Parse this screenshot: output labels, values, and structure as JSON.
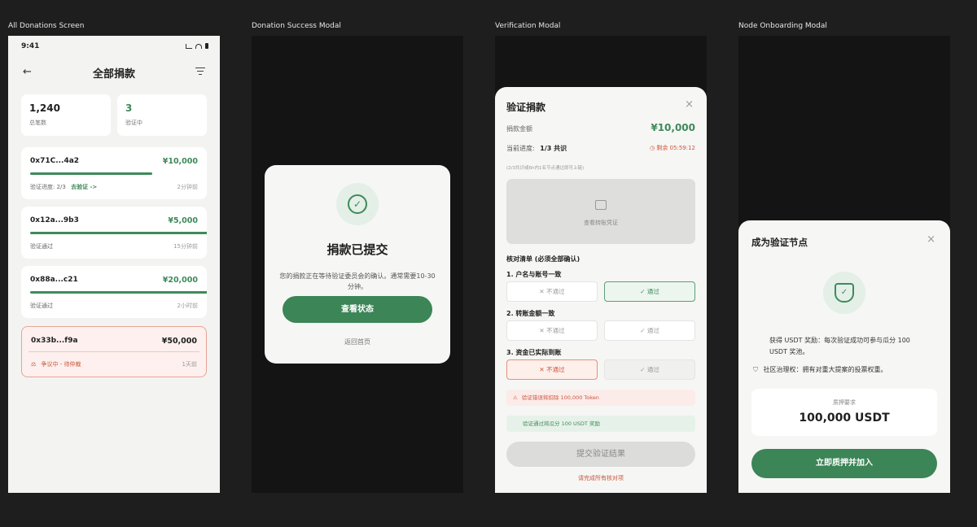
{
  "frames": {
    "all_donations": "All Donations Screen",
    "success": "Donation Success Modal",
    "verification": "Verification Modal",
    "onboarding": "Node Onboarding Modal"
  },
  "screen1": {
    "time": "9:41",
    "title": "全部捐款",
    "stats": [
      {
        "value": "1,240",
        "label": "总笔数"
      },
      {
        "value": "3",
        "label": "验证中"
      }
    ],
    "donations": [
      {
        "addr": "0x71C...4a2",
        "amount": "¥10,000",
        "progress": 0.67,
        "status": "验证进度: 2/3",
        "link": "去验证 ->",
        "time": "2分钟前"
      },
      {
        "addr": "0x12a...9b3",
        "amount": "¥5,000",
        "progress": 1.0,
        "status": "验证通过",
        "time": "15分钟前"
      },
      {
        "addr": "0x88a...c21",
        "amount": "¥20,000",
        "progress": 1.0,
        "status": "验证通过",
        "time": "2小时前"
      },
      {
        "addr": "0x33b...f9a",
        "amount": "¥50,000",
        "status": "争议中 - 待仲裁",
        "time": "1天前"
      }
    ]
  },
  "success": {
    "title": "捐款已提交",
    "body": "您的捐款正在等待验证委员会的确认。通常需要10-30 分钟。",
    "primary": "查看状态",
    "secondary": "返回首页"
  },
  "verify": {
    "title": "验证捐款",
    "amount_label": "捐款金额",
    "amount": "¥10,000",
    "progress_label": "当前进度:",
    "progress_value": "1/3 共识",
    "remaining": "剩余 05:59:12",
    "note": "(2/3共识或6h内1名节点通过即可上链)",
    "proof_label": "查看转账凭证",
    "checklist_title": "核对清单 (必须全部确认)",
    "items": [
      {
        "label": "1. 户名与账号一致",
        "fail": "不通过",
        "pass": "通过"
      },
      {
        "label": "2. 转账金额一致",
        "fail": "不通过",
        "pass": "通过"
      },
      {
        "label": "3. 资金已实际到账",
        "fail": "不通过",
        "pass": "通过"
      }
    ],
    "warn": "验证错误将扣除 100,000 Token",
    "reward": "验证通过将瓜分 100 USDT 奖励",
    "submit": "提交验证结果",
    "hint": "请完成所有核对项"
  },
  "node": {
    "title": "成为验证节点",
    "benefit1": "获得 USDT 奖励：每次验证成功可参与瓜分 100 USDT 奖池。",
    "benefit2": "社区治理权：拥有对重大提案的投票权重。",
    "stake_label": "质押要求",
    "stake_value": "100,000 USDT",
    "cta": "立即质押并加入"
  },
  "colors": {
    "accent": "#3b8557",
    "danger": "#c9573e",
    "bg": "#1e1e1e"
  }
}
